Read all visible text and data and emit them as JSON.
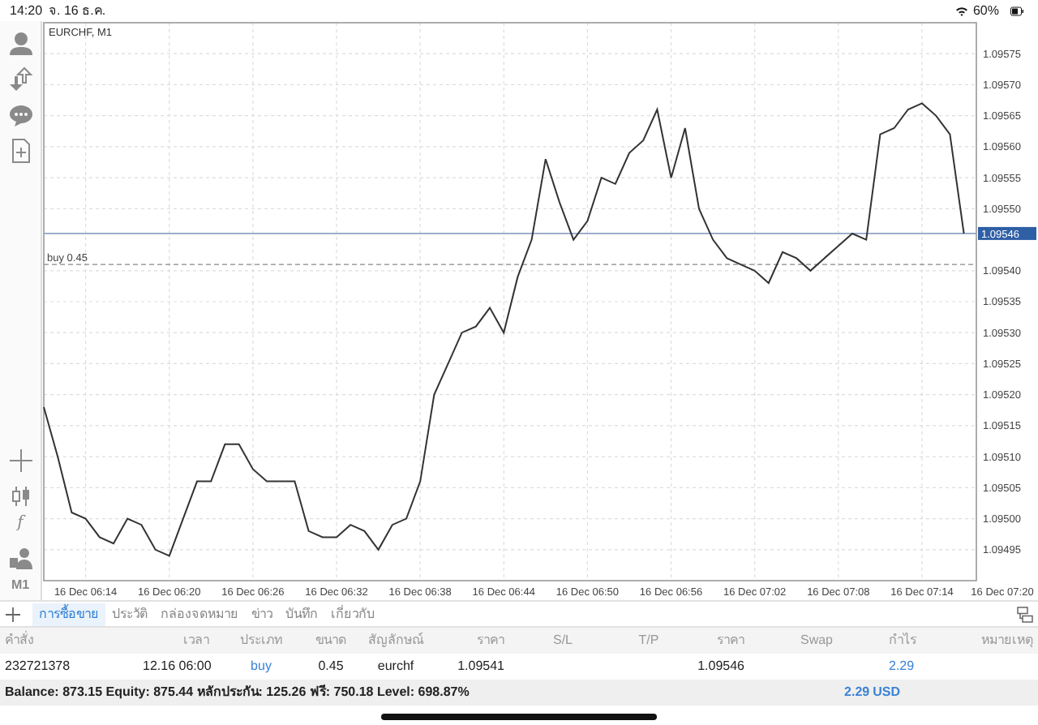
{
  "status_bar": {
    "time": "14:20",
    "date": "จ. 16 ธ.ค.",
    "battery": "60%"
  },
  "left_toolbar": {
    "function_label": "f",
    "timeframe": "M1"
  },
  "chart": {
    "title": "EURCHF, M1",
    "chart_data": {
      "type": "line",
      "categories": [
        null,
        null,
        null,
        "16 Dec 06:14",
        null,
        null,
        null,
        null,
        null,
        "16 Dec 06:20",
        null,
        null,
        null,
        null,
        null,
        "16 Dec 06:26",
        null,
        null,
        null,
        null,
        null,
        "16 Dec 06:32",
        null,
        null,
        null,
        null,
        null,
        "16 Dec 06:38",
        null,
        null,
        null,
        null,
        null,
        "16 Dec 06:44",
        null,
        null,
        null,
        null,
        null,
        "16 Dec 06:50",
        null,
        null,
        null,
        null,
        null,
        "16 Dec 06:56",
        null,
        null,
        null,
        null,
        null,
        "16 Dec 07:02",
        null,
        null,
        null,
        null,
        null,
        "16 Dec 07:08",
        null,
        null,
        null,
        null,
        null,
        "16 Dec 07:14",
        null,
        null,
        null,
        null,
        null,
        "16 Dec 07:20"
      ],
      "series": [
        {
          "color": "#333333",
          "values": [
            1.09518,
            1.0951,
            1.09501,
            1.095,
            1.09497,
            1.09496,
            1.095,
            1.09499,
            1.09495,
            1.09494,
            1.095,
            1.09506,
            1.09506,
            1.09512,
            1.09512,
            1.09508,
            1.09506,
            1.09506,
            1.09506,
            1.09498,
            1.09497,
            1.09497,
            1.09499,
            1.09498,
            1.09495,
            1.09499,
            1.095,
            1.09506,
            1.0952,
            1.09525,
            1.0953,
            1.09531,
            1.09534,
            1.0953,
            1.09539,
            1.09545,
            1.09558,
            1.09551,
            1.09545,
            1.09548,
            1.09555,
            1.09554,
            1.09559,
            1.09561,
            1.09566,
            1.09555,
            1.09563,
            1.0955,
            1.09545,
            1.09542,
            1.09541,
            1.0954,
            1.09538,
            1.09543,
            1.09542,
            1.0954,
            1.09542,
            1.09544,
            1.09546,
            1.09545,
            1.09562,
            1.09563,
            1.09566,
            1.09567,
            1.09565,
            1.09562,
            1.09546,
            null,
            null,
            null
          ]
        }
      ],
      "ylim": [
        1.0949,
        1.0958
      ],
      "yticks": [
        {
          "value": 1.09495,
          "label": "1.09495"
        },
        {
          "value": 1.095,
          "label": "1.09500"
        },
        {
          "value": 1.09505,
          "label": "1.09505"
        },
        {
          "value": 1.0951,
          "label": "1.09510"
        },
        {
          "value": 1.09515,
          "label": "1.09515"
        },
        {
          "value": 1.0952,
          "label": "1.09520"
        },
        {
          "value": 1.09525,
          "label": "1.09525"
        },
        {
          "value": 1.0953,
          "label": "1.09530"
        },
        {
          "value": 1.09535,
          "label": "1.09535"
        },
        {
          "value": 1.0954,
          "label": "1.09540"
        },
        {
          "value": 1.0955,
          "label": "1.09550"
        },
        {
          "value": 1.09555,
          "label": "1.09555"
        },
        {
          "value": 1.0956,
          "label": "1.09560"
        },
        {
          "value": 1.09565,
          "label": "1.09565"
        },
        {
          "value": 1.0957,
          "label": "1.09570"
        },
        {
          "value": 1.09575,
          "label": "1.09575"
        }
      ],
      "grid": true,
      "ref_lines": [
        {
          "axis": "y",
          "value": 1.09546,
          "label": "1.09546"
        },
        {
          "axis": "y",
          "value": 1.09541,
          "label": "buy 0.45"
        }
      ]
    }
  },
  "tabs": [
    {
      "label": "การซื้อขาย",
      "selected": true
    },
    {
      "label": "ประวัติ",
      "selected": false
    },
    {
      "label": "กล่องจดหมาย",
      "selected": false
    },
    {
      "label": "ข่าว",
      "selected": false
    },
    {
      "label": "บันทึก",
      "selected": false
    },
    {
      "label": "เกี่ยวกับ",
      "selected": false
    }
  ],
  "table": {
    "columns": [
      "คำสั่ง",
      "เวลา",
      "ประเภท",
      "ขนาด",
      "สัญลักษณ์",
      "ราคา",
      "S/L",
      "T/P",
      "ราคา",
      "Swap",
      "กำไร",
      "หมายเหตุ"
    ],
    "rows": [
      {
        "cells": [
          "232721378",
          "12.16 06:00",
          "buy",
          "0.45",
          "eurchf",
          "1.09541",
          "",
          "",
          "1.09546",
          "",
          "2.29",
          ""
        ]
      }
    ]
  },
  "summary": {
    "text": "Balance: 873.15 Equity: 875.44 หลักประกัน: 125.26 ฟรี: 750.18 Level: 698.87%",
    "profit": "2.29",
    "currency": "USD"
  }
}
